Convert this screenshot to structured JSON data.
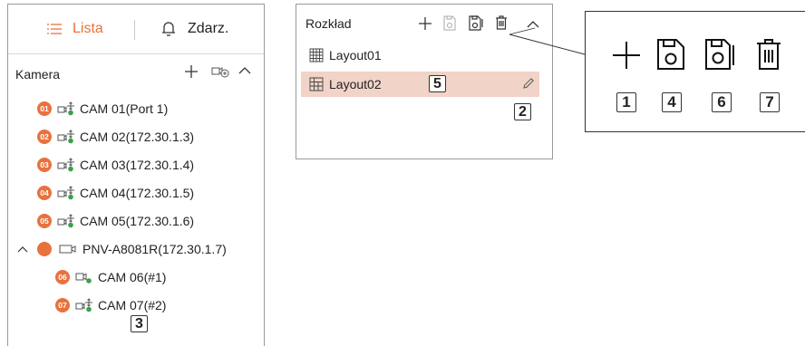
{
  "tabs": {
    "list_label": "Lista",
    "events_label": "Zdarz."
  },
  "camera_section": {
    "title": "Kamera",
    "cameras": [
      {
        "badge": "01",
        "label": "CAM 01(Port 1)"
      },
      {
        "badge": "02",
        "label": "CAM 02(172.30.1.3)"
      },
      {
        "badge": "03",
        "label": "CAM 03(172.30.1.4)"
      },
      {
        "badge": "04",
        "label": "CAM 04(172.30.1.5)"
      },
      {
        "badge": "05",
        "label": "CAM 05(172.30.1.6)"
      }
    ],
    "group": {
      "label": "PNV-A8081R(172.30.1.7)",
      "children": [
        {
          "badge": "06",
          "label": "CAM 06(#1)"
        },
        {
          "badge": "07",
          "label": "CAM 07(#2)"
        }
      ]
    },
    "callout_number": "3"
  },
  "layout_section": {
    "title": "Rozkład",
    "layouts": [
      {
        "label": "Layout01"
      },
      {
        "label": "Layout02"
      }
    ],
    "selected_callout": "5",
    "edit_callout": "2"
  },
  "callout_legend": {
    "add": "1",
    "save": "4",
    "save_as": "6",
    "delete": "7"
  },
  "colors": {
    "accent": "#e8723d",
    "selected_row": "#f1d3c7"
  }
}
